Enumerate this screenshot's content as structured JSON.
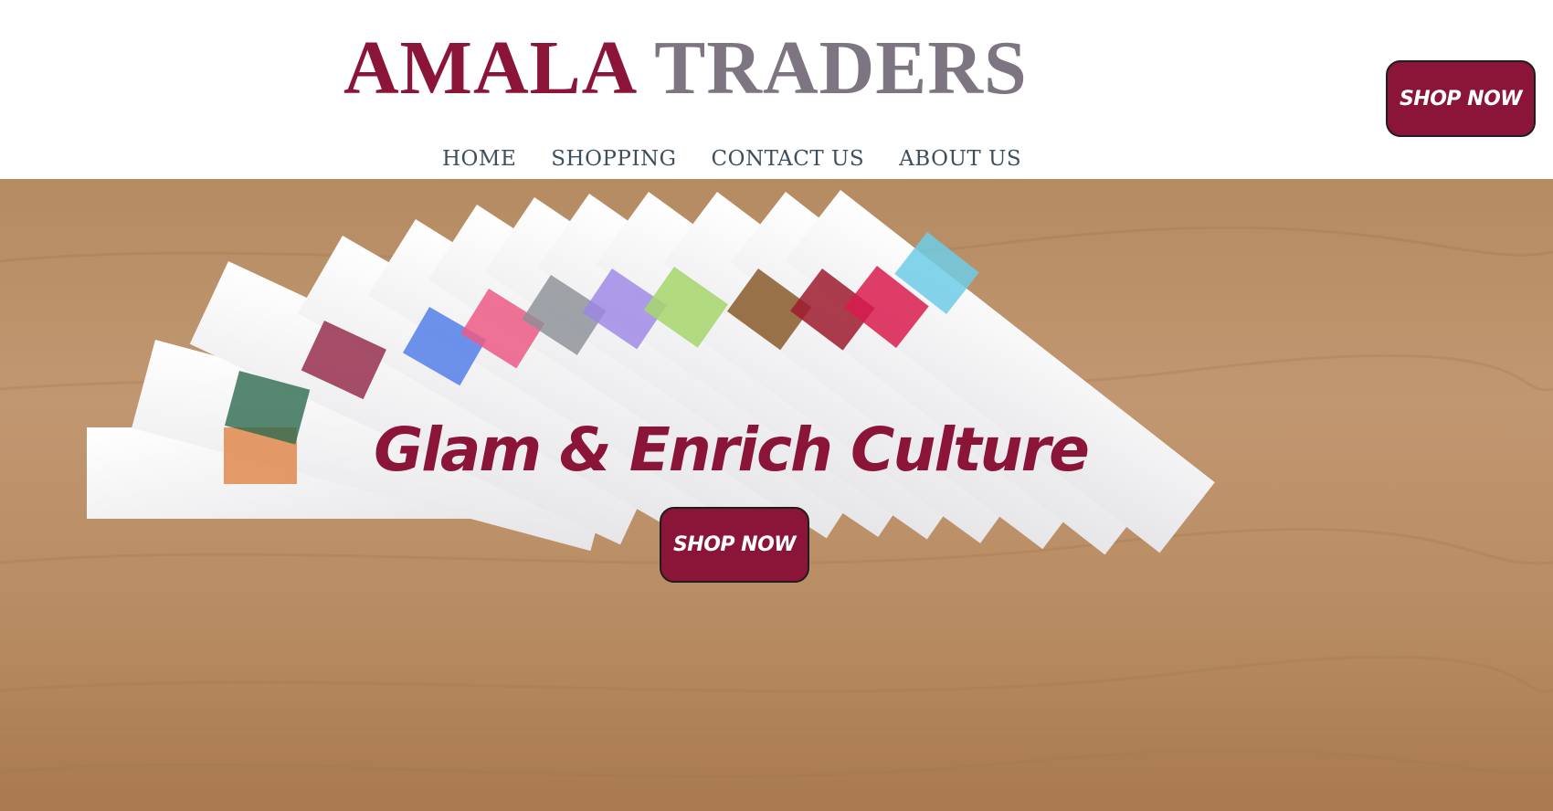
{
  "brand": {
    "word1": "AMALA",
    "word2": "TRADERS"
  },
  "nav": {
    "items": [
      "HOME",
      "SHOPPING",
      "CONTACT US",
      "ABOUT US"
    ]
  },
  "header_cta": {
    "label": "SHOP NOW"
  },
  "hero": {
    "headline": "Glam & Enrich Culture",
    "cta_label": "SHOP NOW"
  },
  "colors": {
    "brand_maroon": "#8b1538",
    "brand_gray": "#7d7581",
    "nav_text": "#3d4f5c",
    "wood": "#b88c62"
  },
  "icons": {
    "hero_image": "folded-striped-handkerchiefs-photo"
  }
}
